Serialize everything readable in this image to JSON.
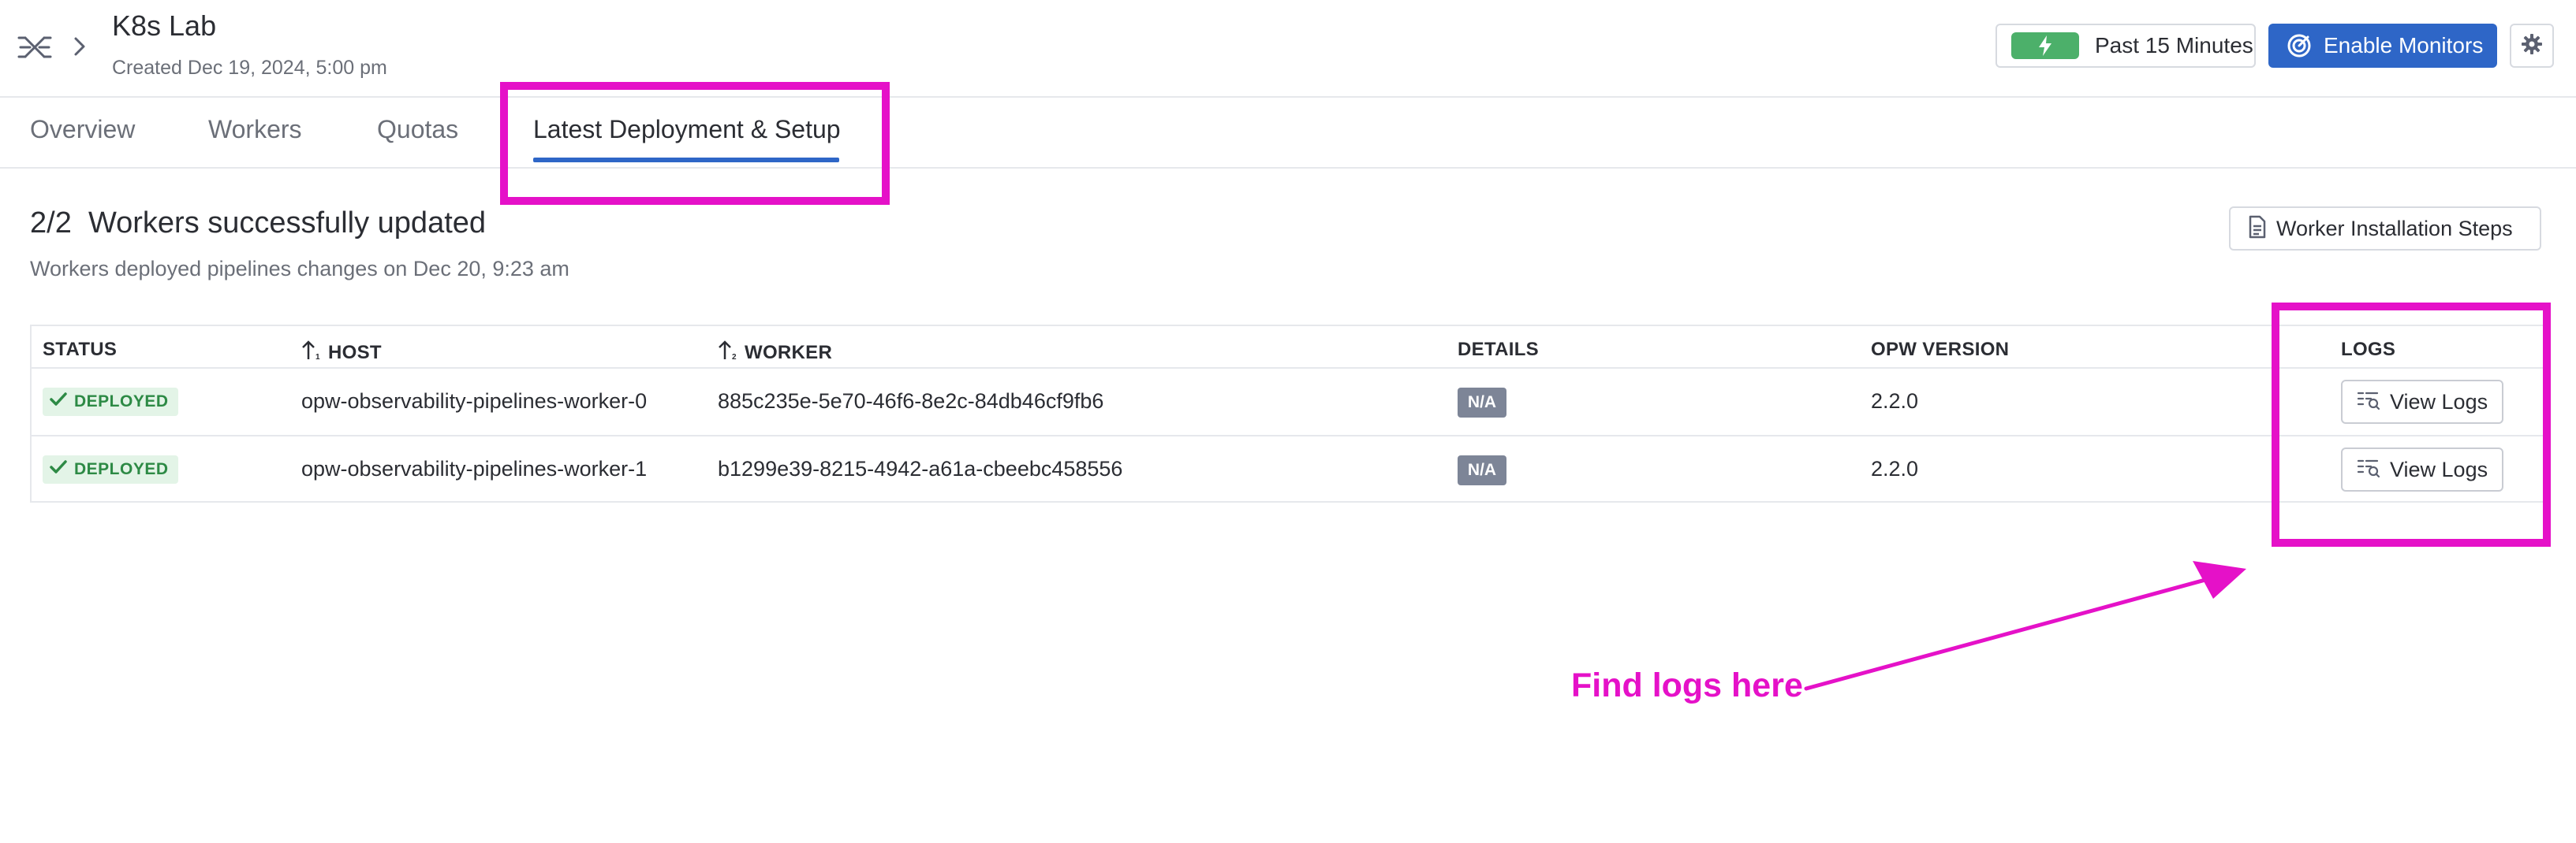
{
  "header": {
    "title": "K8s Lab",
    "subtitle": "Created Dec 19, 2024, 5:00 pm",
    "time_button": "Past 15 Minutes",
    "monitors_button": "Enable Monitors"
  },
  "tabs": [
    {
      "label": "Overview",
      "active": false
    },
    {
      "label": "Workers",
      "active": false
    },
    {
      "label": "Quotas",
      "active": false
    },
    {
      "label": "Latest Deployment & Setup",
      "active": true
    }
  ],
  "summary": {
    "count": "2/2",
    "title": "Workers successfully updated",
    "subtitle": "Workers deployed pipelines changes on Dec 20, 9:23 am",
    "install_button": "Worker Installation Steps"
  },
  "table": {
    "headers": {
      "status": "STATUS",
      "host": "HOST",
      "worker": "WORKER",
      "details": "DETAILS",
      "version": "OPW VERSION",
      "logs": "LOGS"
    },
    "rows": [
      {
        "status": "DEPLOYED",
        "host": "opw-observability-pipelines-worker-0",
        "worker": "885c235e-5e70-46f6-8e2c-84db46cf9fb6",
        "details": "N/A",
        "version": "2.2.0",
        "logs_button": "View Logs"
      },
      {
        "status": "DEPLOYED",
        "host": "opw-observability-pipelines-worker-1",
        "worker": "b1299e39-8215-4942-a61a-cbeebc458556",
        "details": "N/A",
        "version": "2.2.0",
        "logs_button": "View Logs"
      }
    ]
  },
  "annotation": {
    "text": "Find logs here",
    "color": "#e511c8"
  },
  "colors": {
    "accent": "#2e66c7",
    "success": "#2d8a45",
    "time_badge": "#4cb06a",
    "na_badge": "#7d8597"
  },
  "icons": [
    "pipelines-icon",
    "chevron-right-icon",
    "bolt-icon",
    "monitor-icon",
    "gear-icon",
    "document-icon",
    "sort-icon",
    "check-icon",
    "logs-icon"
  ]
}
